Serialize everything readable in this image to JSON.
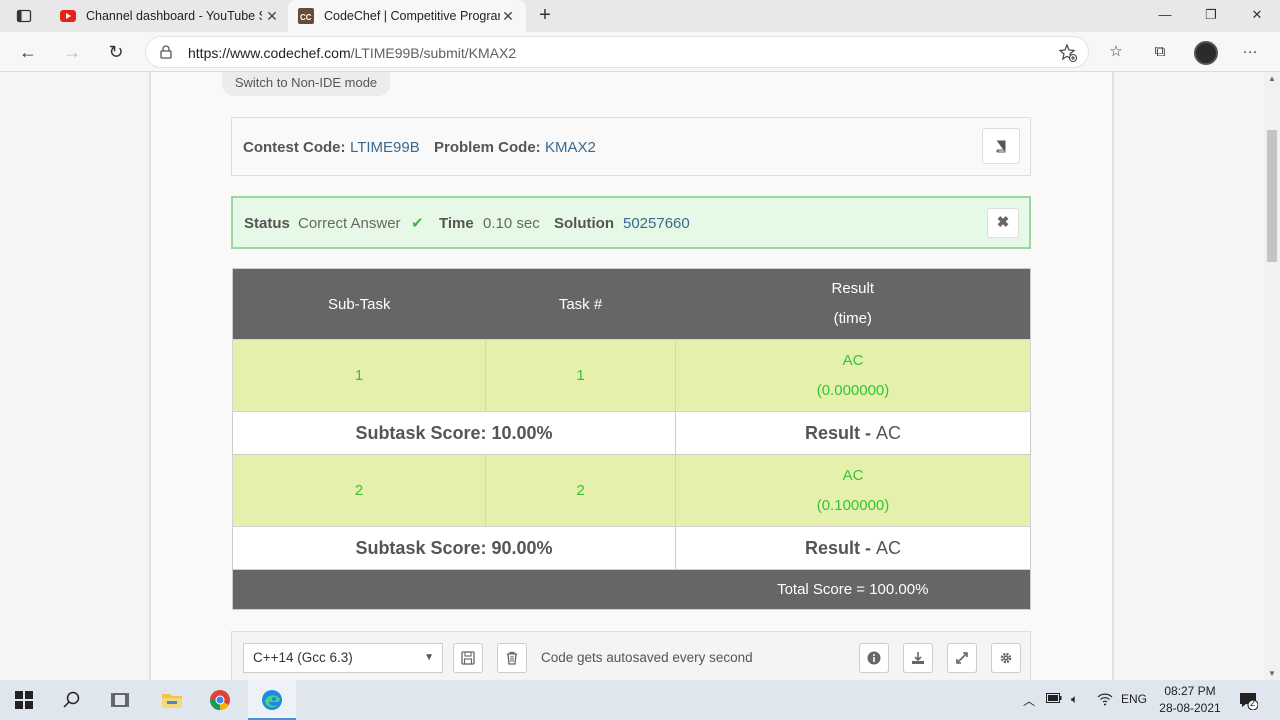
{
  "browser": {
    "tabs": [
      {
        "title": "Channel dashboard - YouTube Studio",
        "icon": "youtube-icon",
        "active": false
      },
      {
        "title": "CodeChef | Competitive Programming",
        "icon": "codechef-icon",
        "active": true
      }
    ],
    "url_host": "https://www.codechef.com",
    "url_path": "/LTIME99B/submit/KMAX2"
  },
  "page": {
    "switch_mode_label": "Switch to Non-IDE mode",
    "contest_code_label": "Contest Code:",
    "contest_code": "LTIME99B",
    "problem_code_label": "Problem Code:",
    "problem_code": "KMAX2",
    "status": {
      "status_label": "Status",
      "status_value": "Correct Answer",
      "time_label": "Time",
      "time_value": "0.10 sec",
      "solution_label": "Solution",
      "solution_id": "50257660"
    },
    "results": {
      "headers": {
        "subtask": "Sub-Task",
        "task": "Task #",
        "result": "Result",
        "result_sub": "(time)"
      },
      "rows": [
        {
          "subtask": "1",
          "task": "1",
          "result": "AC",
          "time": "(0.000000)",
          "score_label": "Subtask Score: 10.00%",
          "result_label": "Result - ",
          "result_value": "AC"
        },
        {
          "subtask": "2",
          "task": "2",
          "result": "AC",
          "time": "(0.100000)",
          "score_label": "Subtask Score: 90.00%",
          "result_label": "Result - ",
          "result_value": "AC"
        }
      ],
      "total": "Total Score = 100.00%"
    },
    "editor": {
      "language": "C++14 (Gcc 6.3)",
      "autosave_text": "Code gets autosaved every second"
    }
  },
  "taskbar": {
    "language": "ENG",
    "time": "08:27 PM",
    "date": "28-08-2021",
    "notifications": "2"
  },
  "colors": {
    "accent": "#3a6a8f",
    "success": "#35c435",
    "status_bg": "#e6f9e6",
    "header_bg": "#666666",
    "case_bg": "#e5f0ad"
  }
}
